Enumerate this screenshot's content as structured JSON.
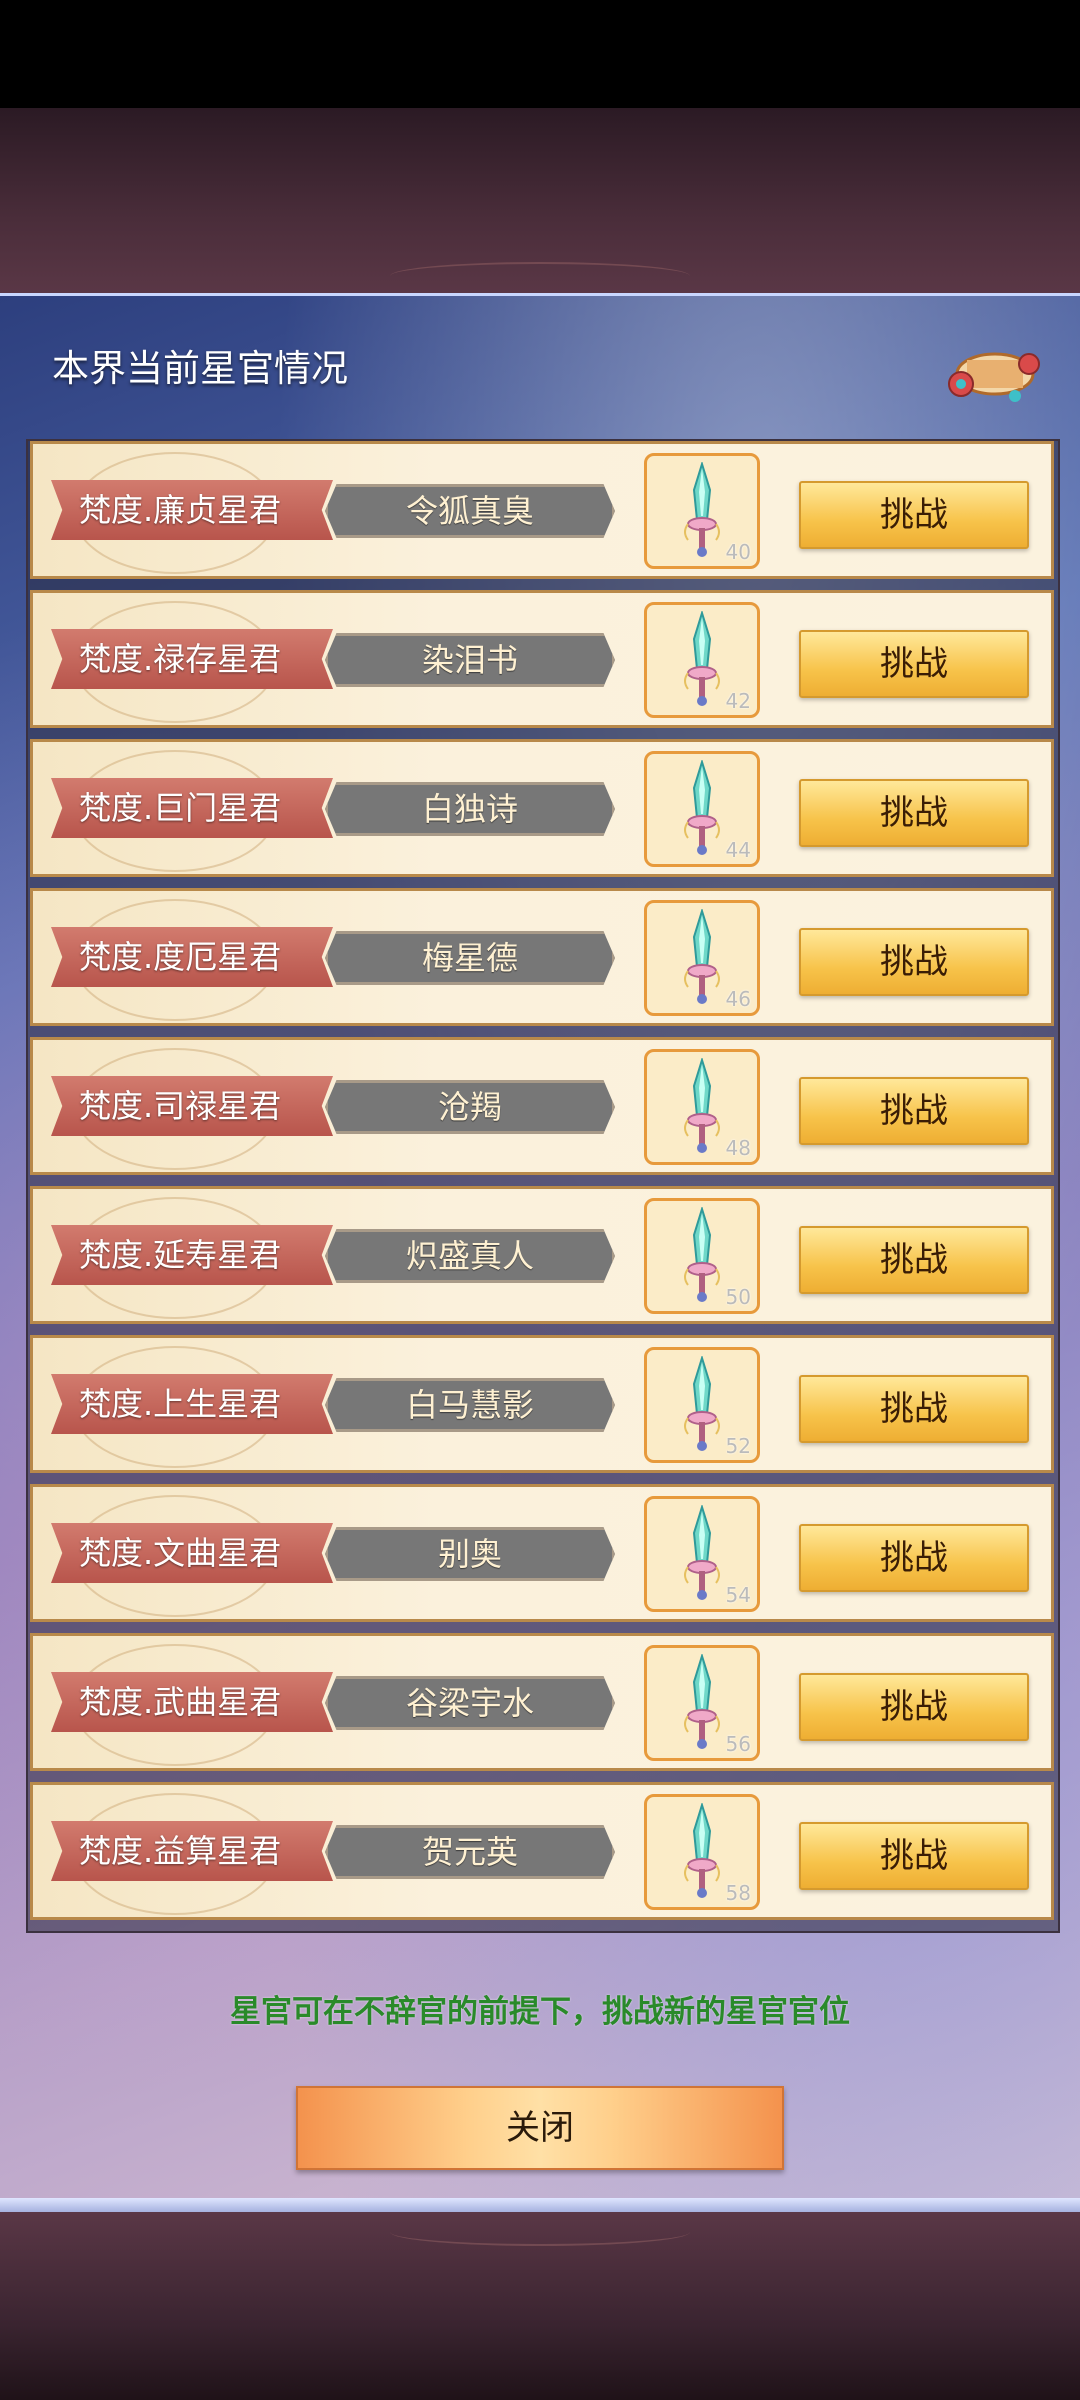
{
  "panel": {
    "title": "本界当前星官情况",
    "tip": "星官可在不辞官的前提下，挑战新的星官官位",
    "close_label": "关闭"
  },
  "rows": [
    {
      "title": "梵度.廉贞星君",
      "name": "令狐真臭",
      "level": "40",
      "button": "挑战"
    },
    {
      "title": "梵度.禄存星君",
      "name": "染泪书",
      "level": "42",
      "button": "挑战"
    },
    {
      "title": "梵度.巨门星君",
      "name": "白独诗",
      "level": "44",
      "button": "挑战"
    },
    {
      "title": "梵度.度厄星君",
      "name": "梅星德",
      "level": "46",
      "button": "挑战"
    },
    {
      "title": "梵度.司禄星君",
      "name": "沧羯",
      "level": "48",
      "button": "挑战"
    },
    {
      "title": "梵度.延寿星君",
      "name": "炽盛真人",
      "level": "50",
      "button": "挑战"
    },
    {
      "title": "梵度.上生星君",
      "name": "白马慧影",
      "level": "52",
      "button": "挑战"
    },
    {
      "title": "梵度.文曲星君",
      "name": "别奥",
      "level": "54",
      "button": "挑战"
    },
    {
      "title": "梵度.武曲星君",
      "name": "谷梁宇水",
      "level": "56",
      "button": "挑战"
    },
    {
      "title": "梵度.益算星君",
      "name": "贺元英",
      "level": "58",
      "button": "挑战"
    }
  ],
  "colors": {
    "button": "#f7c34a",
    "ribbon": "#c0665a",
    "tip": "#2a8a2a"
  }
}
